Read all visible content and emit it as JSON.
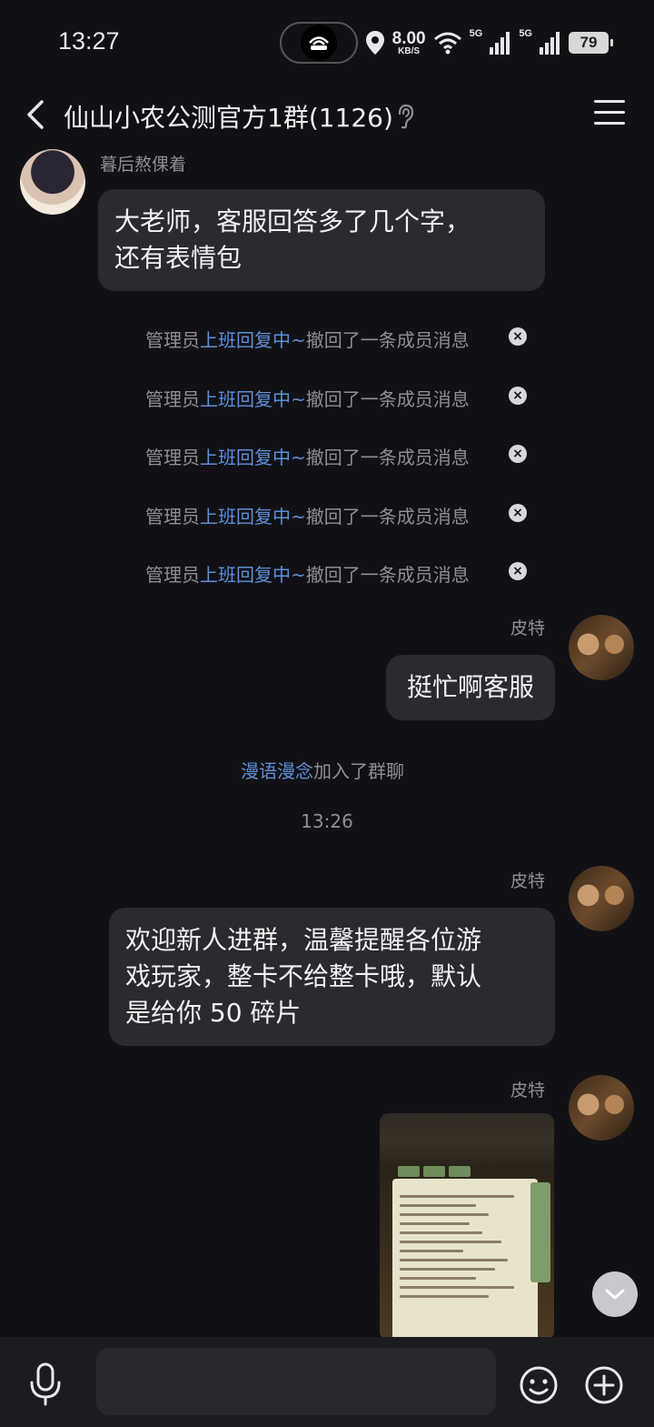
{
  "status": {
    "time": "13:27",
    "speed_value": "8.00",
    "speed_unit": "KB/S",
    "net1": "5G",
    "net2": "5G",
    "battery": "79"
  },
  "header": {
    "title": "仙山小农公测官方1群(1126)"
  },
  "messages": {
    "m1": {
      "sender": "暮后熬倮着",
      "text_line1": "大老师，客服回答多了几个字，",
      "text_line2": "还有表情包"
    },
    "recalls": [
      {
        "prefix": "管理员",
        "name": "上班回复中~",
        "suffix": "撤回了一条成员消息"
      },
      {
        "prefix": "管理员",
        "name": "上班回复中~",
        "suffix": "撤回了一条成员消息"
      },
      {
        "prefix": "管理员",
        "name": "上班回复中~",
        "suffix": "撤回了一条成员消息"
      },
      {
        "prefix": "管理员",
        "name": "上班回复中~",
        "suffix": "撤回了一条成员消息"
      },
      {
        "prefix": "管理员",
        "name": "上班回复中~",
        "suffix": "撤回了一条成员消息"
      }
    ],
    "m2": {
      "sender": "皮特",
      "text": "挺忙啊客服"
    },
    "join": {
      "name": "漫语漫念",
      "suffix": "加入了群聊"
    },
    "timestamp": "13:26",
    "m3": {
      "sender": "皮特",
      "line1": "欢迎新人进群，温馨提醒各位游",
      "line2": "戏玩家，整卡不给整卡哦，默认",
      "line3": "是给你 50 碎片"
    },
    "m4": {
      "sender": "皮特"
    }
  },
  "icons": {
    "back": "chevron-left-icon",
    "menu": "hamburger-icon",
    "ear": "ear-icon",
    "mic": "microphone-icon",
    "emoji": "smiley-icon",
    "plus": "plus-circle-icon",
    "scroll": "chevron-down-icon"
  },
  "colors": {
    "background": "#111115",
    "bubble": "#2b2b2f",
    "link": "#5f8fd9"
  }
}
